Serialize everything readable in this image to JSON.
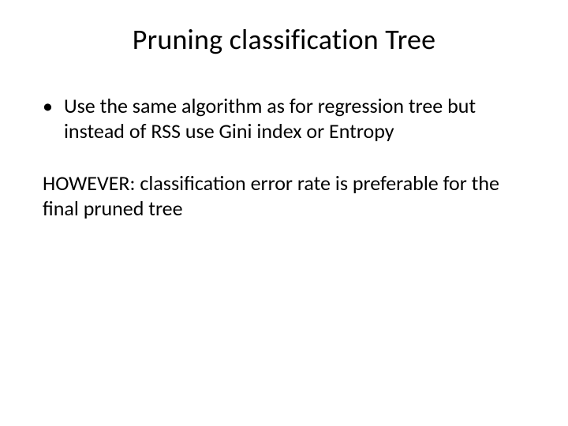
{
  "slide": {
    "title": "Pruning classification Tree",
    "bullet_marker": "•",
    "bullet1": "Use the same algorithm as for regression tree but instead of RSS use Gini index or Entropy",
    "paragraph1": "HOWEVER: classification error rate is preferable for the final pruned tree"
  }
}
